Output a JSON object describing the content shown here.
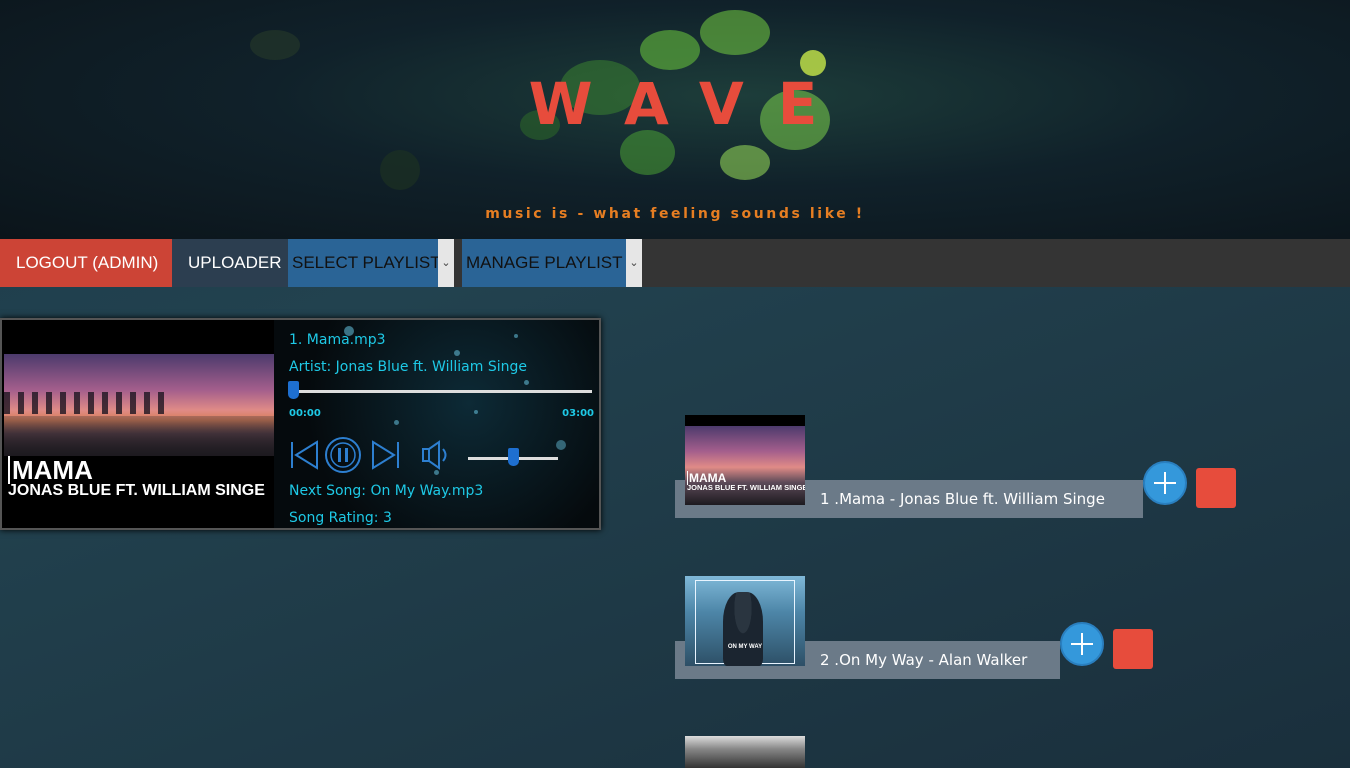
{
  "header": {
    "title": "WAVE",
    "tagline": "music is - what feeling sounds like !"
  },
  "nav": {
    "logout_label": "LOGOUT (ADMIN)",
    "uploader_label": "UPLOADER",
    "select_playlist_label": "SELECT PLAYLIST",
    "manage_playlist_label": "MANAGE PLAYLIST"
  },
  "player": {
    "cover_title": "MAMA",
    "cover_artist": "JONAS BLUE FT. WILLIAM SINGE",
    "track": "1. Mama.mp3",
    "artist": "Artist: Jonas Blue ft. William Singe",
    "time_current": "00:00",
    "time_total": "03:00",
    "progress_fraction": 0.0,
    "volume_fraction": 0.5,
    "next_song": "Next Song: On My Way.mp3",
    "rating": "Song Rating: 3",
    "controls": [
      "previous-icon",
      "pause-icon",
      "next-icon",
      "volume-icon"
    ]
  },
  "playlist": {
    "items": [
      {
        "label": "1 .Mama - Jonas Blue ft. William Singe",
        "thumb_title": "MAMA",
        "thumb_artist": "JONAS BLUE FT. WILLIAM SINGE"
      },
      {
        "label": "2 .On My Way - Alan Walker",
        "thumb_text": "ON MY WAY"
      }
    ]
  },
  "colors": {
    "brand": "#e74c3c",
    "tagline": "#e67e22",
    "accent_text": "#1ec9e6",
    "add_button": "#3498db",
    "delete_button": "#e74c3c"
  }
}
